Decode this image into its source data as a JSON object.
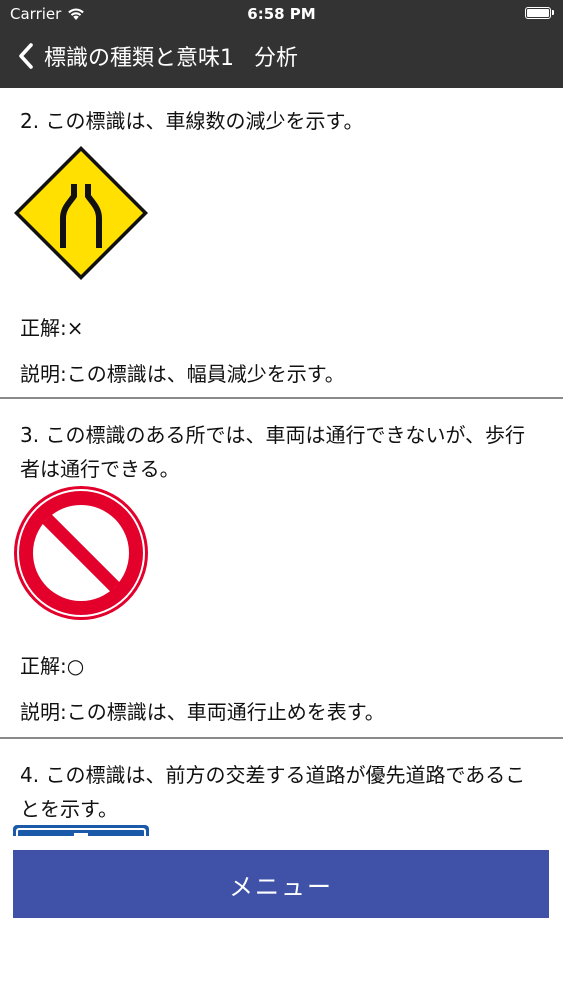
{
  "status_bar": {
    "carrier": "Carrier",
    "time": "6:58 PM",
    "battery_level": 1.0
  },
  "nav": {
    "back_icon": "chevron-left-icon",
    "title": "標識の種類と意味1",
    "subtitle": "分析"
  },
  "questions": [
    {
      "text": "2. この標識は、車線数の減少を示す。",
      "sign": "lane-reduction-sign-icon",
      "answer": "正解:×",
      "explanation": "説明:この標識は、幅員減少を示す。"
    },
    {
      "text": "3. この標識のある所では、車両は通行できないが、歩行者は通行できる。",
      "sign": "no-entry-sign-icon",
      "answer": "正解:○",
      "explanation": "説明:この標識は、車両通行止めを表す。"
    },
    {
      "text": "4. この標識は、前方の交差する道路が優先道路であることを示す。",
      "sign": "priority-road-sign-icon"
    }
  ],
  "menu_button": {
    "label": "メニュー"
  },
  "colors": {
    "nav_bg": "#333333",
    "menu_bg": "#3f52a8",
    "warning_yellow": "#ffe000",
    "prohibition_red": "#e3002b",
    "sign_blue": "#1a5aa8",
    "divider": "#8a8a8a"
  }
}
